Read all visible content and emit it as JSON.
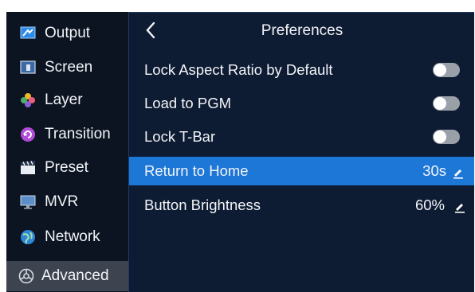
{
  "sidebar": {
    "items": [
      {
        "label": "Output",
        "icon": "output-icon"
      },
      {
        "label": "Screen",
        "icon": "screen-icon"
      },
      {
        "label": "Layer",
        "icon": "layer-icon"
      },
      {
        "label": "Transition",
        "icon": "transition-icon"
      },
      {
        "label": "Preset",
        "icon": "preset-icon"
      },
      {
        "label": "MVR",
        "icon": "mvr-icon"
      },
      {
        "label": "Network",
        "icon": "network-icon"
      },
      {
        "label": "Advanced",
        "icon": "advanced-icon"
      }
    ],
    "active_index": 7
  },
  "panel": {
    "title": "Preferences",
    "back_icon": "chevron-left-icon",
    "rows": [
      {
        "label": "Lock Aspect Ratio by Default",
        "type": "toggle",
        "on": false
      },
      {
        "label": "Load to PGM",
        "type": "toggle",
        "on": false
      },
      {
        "label": "Lock T-Bar",
        "type": "toggle",
        "on": false
      },
      {
        "label": "Return to Home",
        "type": "value",
        "value": "30s",
        "selected": true
      },
      {
        "label": "Button Brightness",
        "type": "value",
        "value": "60%",
        "selected": false
      }
    ]
  },
  "colors": {
    "background": "#0b1320",
    "panel": "#0d1b33",
    "highlight": "#1d77d6",
    "active_sidebar": "#3d4450",
    "toggle_off": "#9aa0a8"
  }
}
